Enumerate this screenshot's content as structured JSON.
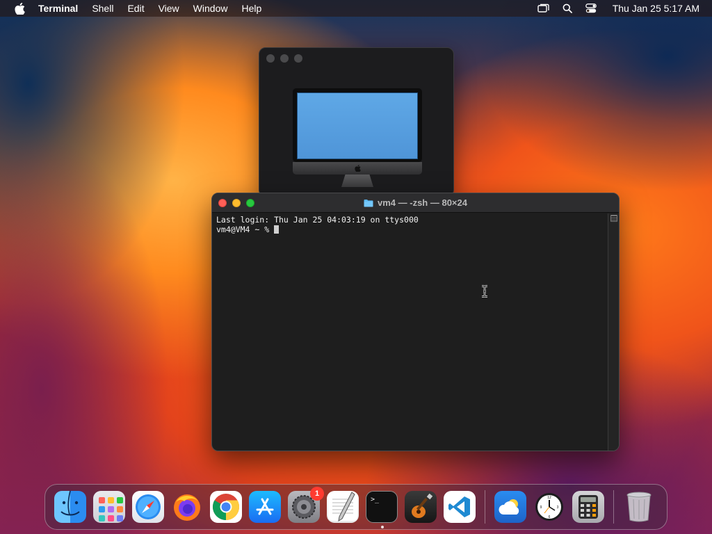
{
  "menubar": {
    "app_name": "Terminal",
    "menus": [
      "Shell",
      "Edit",
      "View",
      "Window",
      "Help"
    ],
    "clock": "Thu Jan 25  5:17 AM",
    "status_icons": [
      "screen-mirroring-icon",
      "search-icon",
      "control-center-icon"
    ]
  },
  "terminal": {
    "title": "vm4 — -zsh — 80×24",
    "lines": [
      "Last login: Thu Jan 25 04:03:19 on ttys000",
      "vm4@VM4 ~ % "
    ]
  },
  "dock": {
    "apps": [
      {
        "name": "Finder",
        "icon": "finder-icon",
        "running": true
      },
      {
        "name": "Launchpad",
        "icon": "launchpad-icon",
        "running": false
      },
      {
        "name": "Safari",
        "icon": "safari-icon",
        "running": false
      },
      {
        "name": "Firefox",
        "icon": "firefox-icon",
        "running": false
      },
      {
        "name": "Google Chrome",
        "icon": "chrome-icon",
        "running": false
      },
      {
        "name": "App Store",
        "icon": "app-store-icon",
        "running": false
      },
      {
        "name": "System Settings",
        "icon": "settings-icon",
        "running": false,
        "badge": "1"
      },
      {
        "name": "TextEdit",
        "icon": "textedit-icon",
        "running": false
      },
      {
        "name": "Terminal",
        "icon": "terminal-icon",
        "running": true
      },
      {
        "name": "GarageBand",
        "icon": "garageband-icon",
        "running": false
      },
      {
        "name": "Visual Studio Code",
        "icon": "vscode-icon",
        "running": false
      },
      {
        "name": "Weather",
        "icon": "weather-icon",
        "running": false
      },
      {
        "name": "Clock",
        "icon": "clock-icon",
        "running": false
      },
      {
        "name": "Calculator",
        "icon": "calculator-icon",
        "running": false
      },
      {
        "name": "Trash",
        "icon": "trash-icon",
        "running": false
      }
    ]
  },
  "colors": {
    "close": "#ff5f57",
    "minimize": "#febc2e",
    "maximize": "#28c840",
    "badge": "#ff3b30",
    "terminal_bg": "#1e1e1e"
  }
}
